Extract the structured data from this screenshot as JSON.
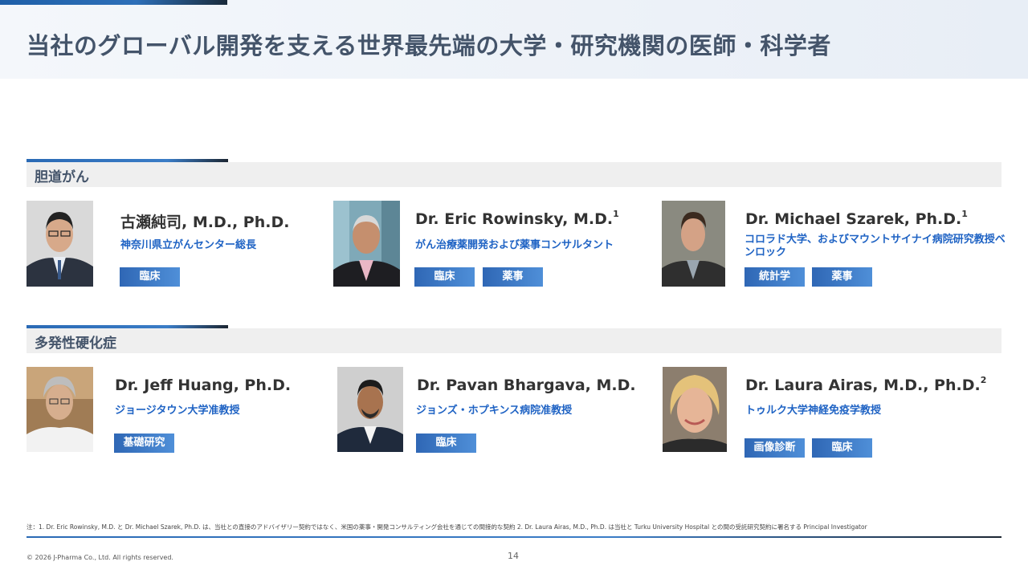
{
  "title": "当社のグローバル開発を支える世界最先端の大学・研究機関の医師・科学者",
  "sections": [
    {
      "label": "胆道がん",
      "people": [
        {
          "name": "古瀬純司, M.D., Ph.D.",
          "sup": "",
          "affiliation": "神奈川県立がんセンター総長",
          "tags": [
            "臨床"
          ]
        },
        {
          "name": "Dr. Eric Rowinsky, M.D.",
          "sup": "1",
          "affiliation": "がん治療薬開発および薬事コンサルタント",
          "tags": [
            "臨床",
            "薬事"
          ]
        },
        {
          "name": "Dr. Michael Szarek, Ph.D.",
          "sup": "1",
          "affiliation": "コロラド大学、およびマウントサイナイ病院研究教授ベンロック",
          "tags": [
            "統計学",
            "薬事"
          ]
        }
      ]
    },
    {
      "label": "多発性硬化症",
      "people": [
        {
          "name": "Dr. Jeff Huang, Ph.D.",
          "sup": "",
          "affiliation": "ジョージタウン大学准教授",
          "tags": [
            "基礎研究"
          ]
        },
        {
          "name": "Dr. Pavan Bhargava, M.D.",
          "sup": "",
          "affiliation": "ジョンズ・ホプキンス病院准教授",
          "tags": [
            "臨床"
          ]
        },
        {
          "name": "Dr. Laura Airas, M.D., Ph.D.",
          "sup": "2",
          "affiliation": "トゥルク大学神経免疫学教授",
          "tags": [
            "画像診断",
            "臨床"
          ]
        }
      ]
    }
  ],
  "footnote": "注：1. Dr. Eric Rowinsky, M.D. と Dr. Michael Szarek, Ph.D. は、当社との直接のアドバイザリー契約ではなく、米国の薬事・開発コンサルティング会社を通じての間接的な契約 2. Dr. Laura Airas, M.D., Ph.D. は当社と Turku University Hospital との間の受託研究契約に署名する Principal Investigator",
  "copyright": "© 2026 J-Pharma Co., Ltd. All rights reserved.",
  "page_number": "14",
  "colors": {
    "title": "#44546a",
    "affiliation": "#1f63c4",
    "tag_start": "#2f67b5",
    "tag_end": "#4f8fd8"
  }
}
